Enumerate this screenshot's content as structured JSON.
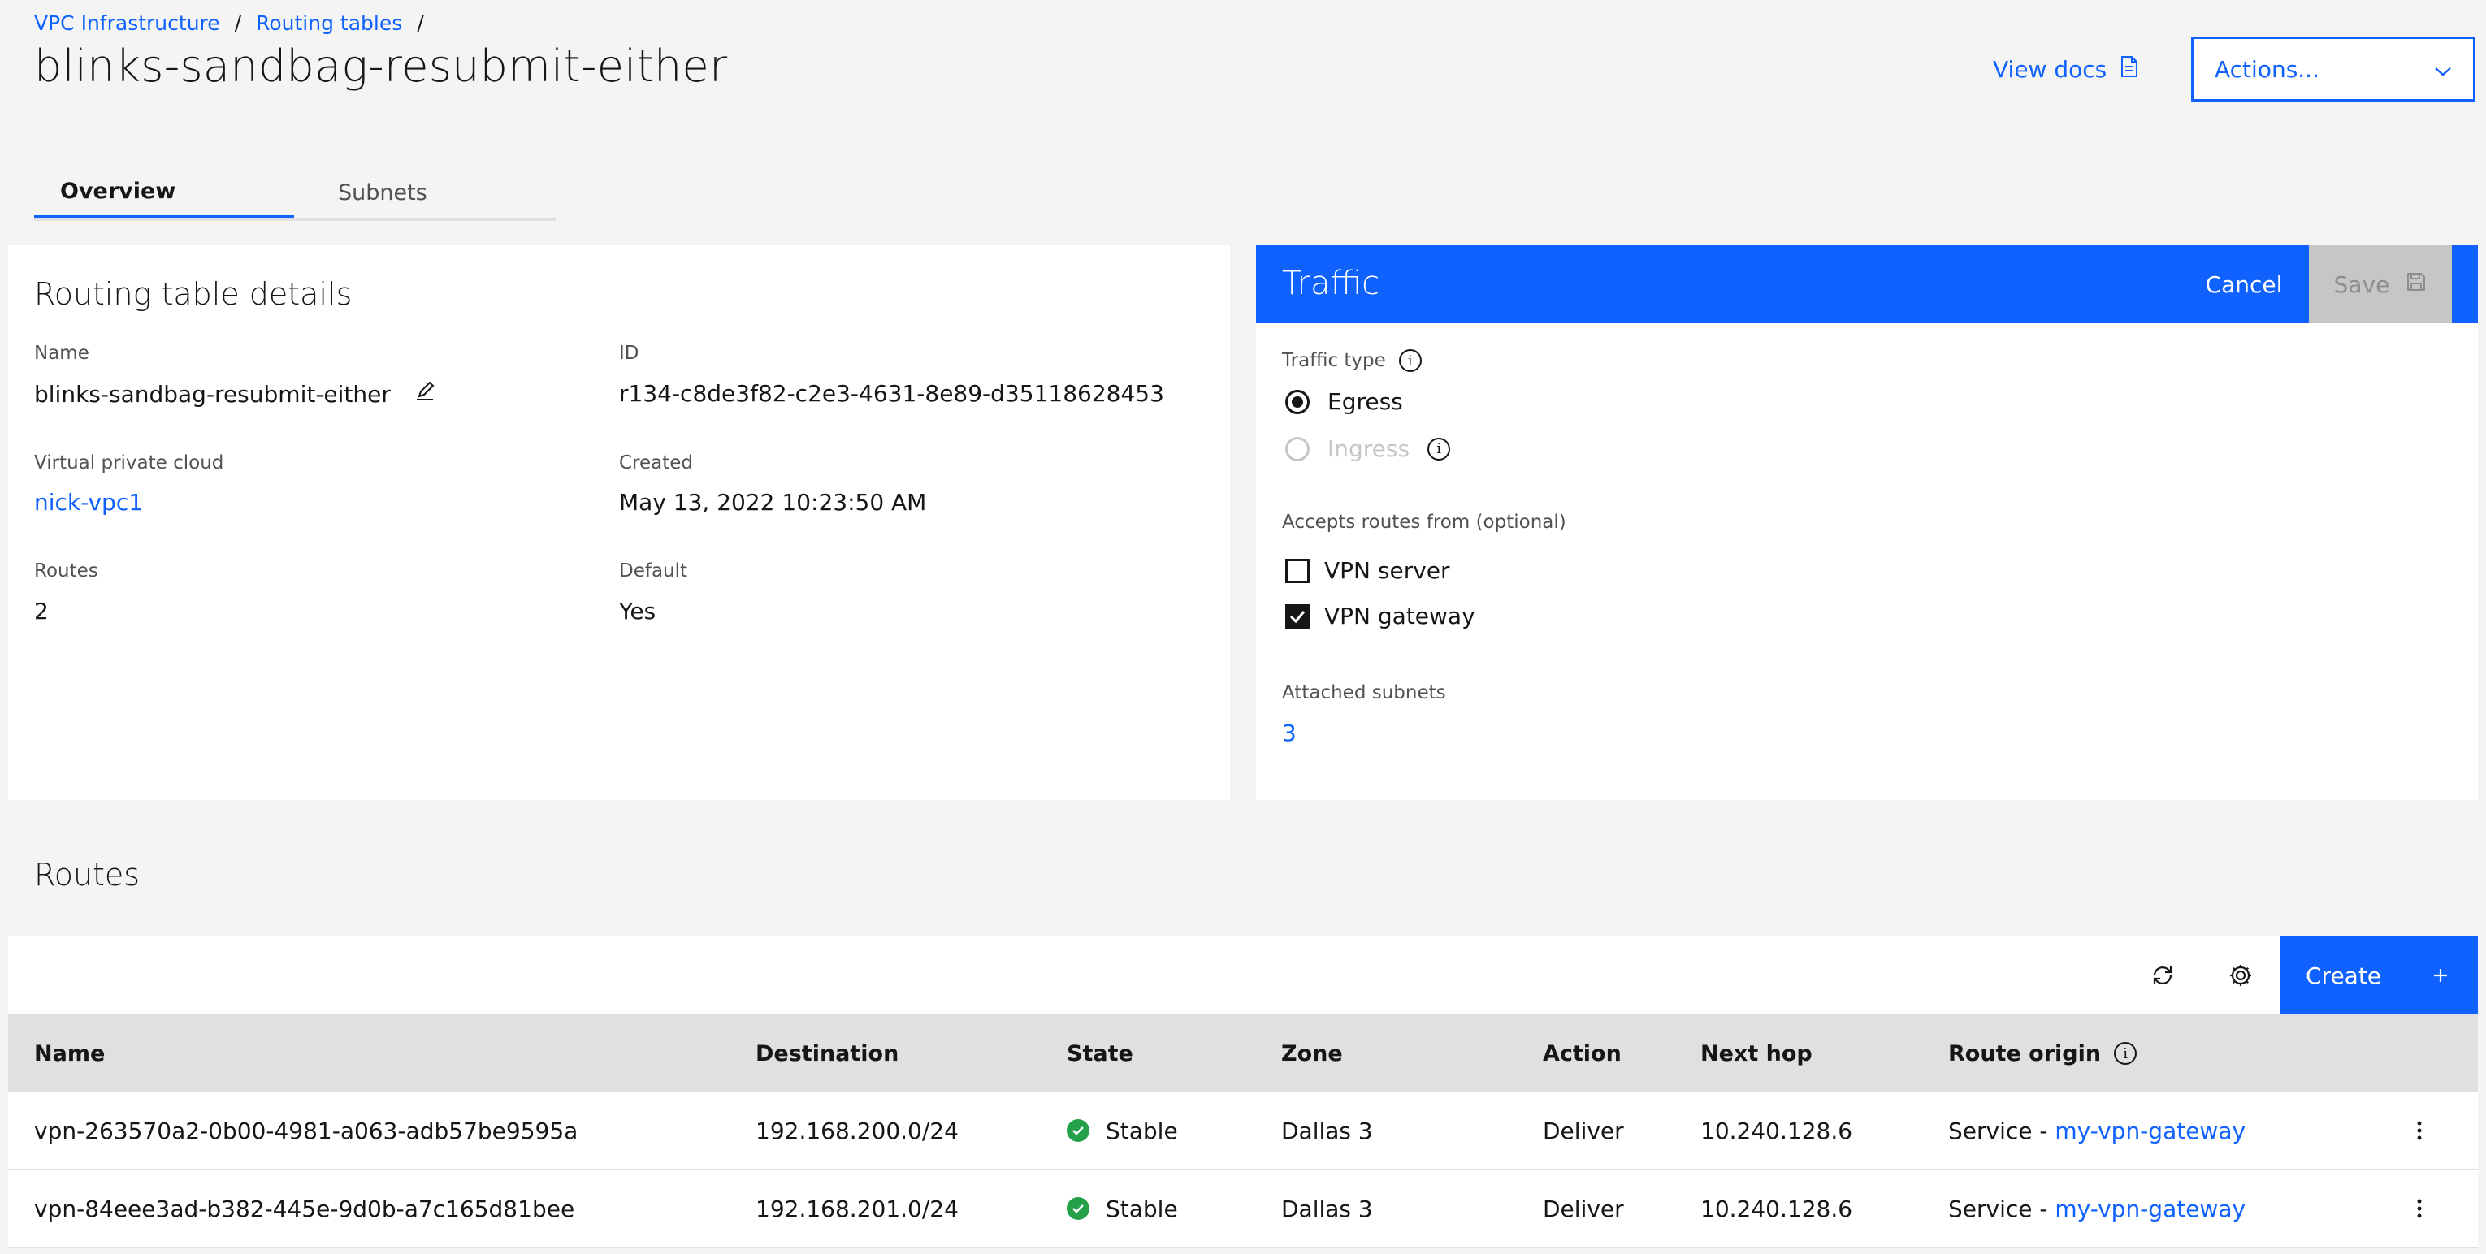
{
  "breadcrumb": {
    "items": [
      "VPC Infrastructure",
      "Routing tables"
    ],
    "separator": "/"
  },
  "page_title": "blinks-sandbag-resubmit-either",
  "header": {
    "view_docs": "View docs",
    "actions": "Actions..."
  },
  "tabs": [
    {
      "label": "Overview",
      "active": true
    },
    {
      "label": "Subnets",
      "active": false
    }
  ],
  "details": {
    "title": "Routing table details",
    "name_label": "Name",
    "name_value": "blinks-sandbag-resubmit-either",
    "id_label": "ID",
    "id_value": "r134-c8de3f82-c2e3-4631-8e89-d35118628453",
    "vpc_label": "Virtual private cloud",
    "vpc_value": "nick-vpc1",
    "created_label": "Created",
    "created_value": "May 13, 2022 10:23:50 AM",
    "routes_label": "Routes",
    "routes_value": "2",
    "default_label": "Default",
    "default_value": "Yes"
  },
  "traffic": {
    "title": "Traffic",
    "cancel": "Cancel",
    "save": "Save",
    "type_label": "Traffic type",
    "egress": "Egress",
    "ingress": "Ingress",
    "accepts_label": "Accepts routes from (optional)",
    "vpn_server": "VPN server",
    "vpn_gateway": "VPN gateway",
    "attached_label": "Attached subnets",
    "attached_value": "3"
  },
  "routes": {
    "title": "Routes",
    "create": "Create",
    "columns": [
      "Name",
      "Destination",
      "State",
      "Zone",
      "Action",
      "Next hop",
      "Route origin"
    ],
    "rows": [
      {
        "name": "vpn-263570a2-0b00-4981-a063-adb57be9595a",
        "destination": "192.168.200.0/24",
        "state": "Stable",
        "zone": "Dallas 3",
        "action": "Deliver",
        "next_hop": "10.240.128.6",
        "origin_prefix": "Service - ",
        "origin_link": "my-vpn-gateway"
      },
      {
        "name": "vpn-84eee3ad-b382-445e-9d0b-a7c165d81bee",
        "destination": "192.168.201.0/24",
        "state": "Stable",
        "zone": "Dallas 3",
        "action": "Deliver",
        "next_hop": "10.240.128.6",
        "origin_prefix": "Service - ",
        "origin_link": "my-vpn-gateway"
      }
    ]
  },
  "colors": {
    "accent": "#0f62fe",
    "stable": "#24a148",
    "disabled": "#c6c6c6"
  }
}
